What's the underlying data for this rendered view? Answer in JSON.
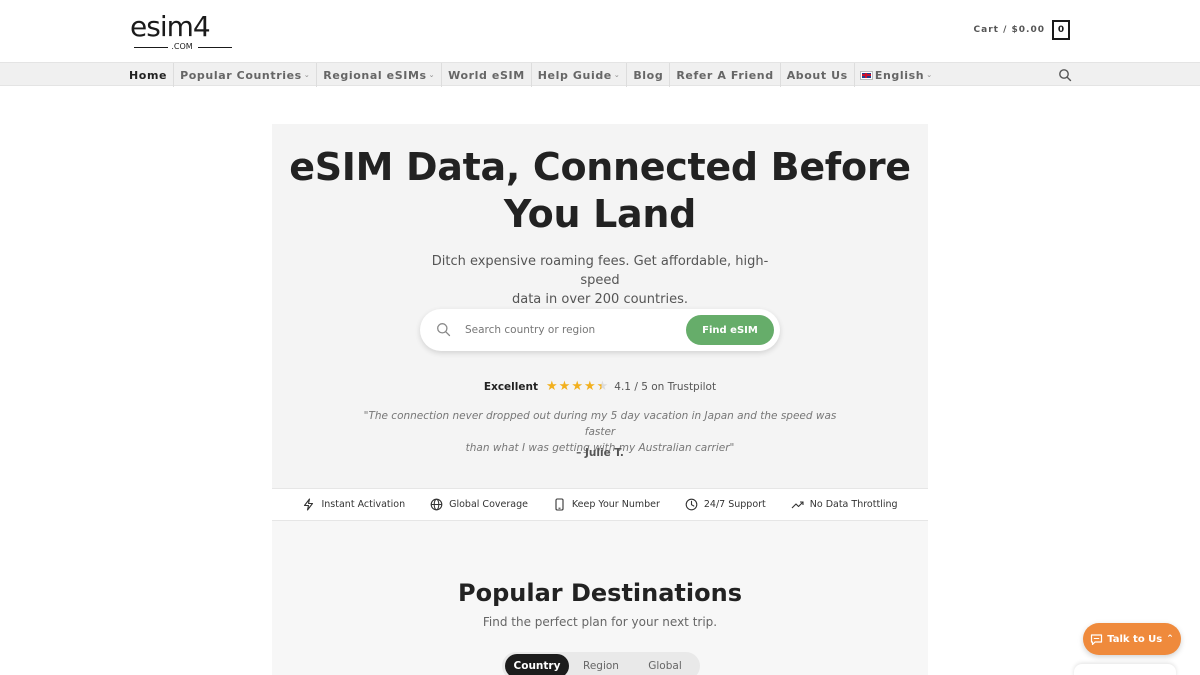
{
  "brand": {
    "logo_text": "esim4",
    "logo_sub": ".COM"
  },
  "cart": {
    "label": "Cart / $0.00",
    "count": "0"
  },
  "nav": {
    "items": [
      {
        "label": "Home"
      },
      {
        "label": "Popular Countries",
        "chev": "⌄"
      },
      {
        "label": "Regional eSIMs",
        "chev": "⌄"
      },
      {
        "label": "World eSIM"
      },
      {
        "label": "Help Guide",
        "chev": "⌄"
      },
      {
        "label": "Blog"
      },
      {
        "label": "Refer A Friend"
      },
      {
        "label": "About Us"
      },
      {
        "label": "English",
        "chev": "⌄"
      }
    ]
  },
  "hero": {
    "title_line1": "eSIM Data, Connected Before",
    "title_line2": "You Land",
    "subtitle_line1": "Ditch expensive roaming fees. Get affordable, high-speed",
    "subtitle_line2": "data in over 200 countries.",
    "search_placeholder": "Search country or region",
    "find_button": "Find eSIM",
    "rating_label": "Excellent",
    "rating_score": 4.1,
    "rating_text": "4.1 / 5 on Trustpilot",
    "quote_line1": "\"The connection never dropped out during my 5 day vacation in Japan and the speed was faster",
    "quote_line2": "than what I was getting with my Australian carrier\"",
    "quote_author": "– Julie T."
  },
  "features": [
    {
      "label": "Instant Activation",
      "icon": "lightning-icon"
    },
    {
      "label": "Global Coverage",
      "icon": "globe-icon"
    },
    {
      "label": "Keep Your Number",
      "icon": "phone-icon"
    },
    {
      "label": "24/7 Support",
      "icon": "clock-icon"
    },
    {
      "label": "No Data Throttling",
      "icon": "trend-up-icon"
    }
  ],
  "popular": {
    "title": "Popular Destinations",
    "subtitle": "Find the perfect plan for your next trip.",
    "tabs": [
      {
        "label": "Country",
        "active": true
      },
      {
        "label": "Region",
        "active": false
      },
      {
        "label": "Global",
        "active": false
      }
    ]
  },
  "chat": {
    "label": "Talk to Us"
  },
  "colors": {
    "accent_green": "#66ad6a",
    "chat_orange": "#ef8a3c",
    "star": "#f2b01e"
  }
}
